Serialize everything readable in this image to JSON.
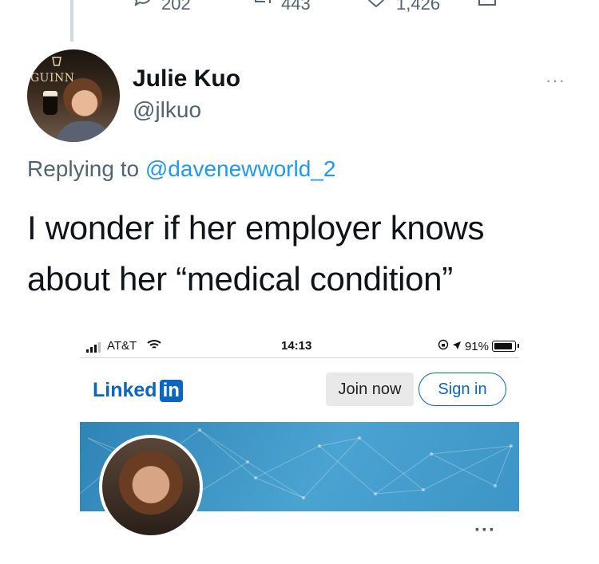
{
  "tweet_actions": {
    "replies": "202",
    "retweets": "443",
    "likes": "1,426"
  },
  "tweet": {
    "author_name": "Julie Kuo",
    "author_handle": "@jlkuo",
    "more_glyph": "···",
    "replying_prefix": "Replying to",
    "replying_to": "@davenewworld_2",
    "text": "I wonder if her employer knows about her “medical condition”",
    "avatar_sign_text": "GUINN"
  },
  "screenshot": {
    "status_bar": {
      "carrier": "AT&T",
      "time": "14:13",
      "battery": "91%",
      "battery_level": 0.91
    },
    "linkedin": {
      "logo_word": "Linked",
      "logo_box": "in",
      "join_label": "Join now",
      "signin_label": "Sign in",
      "more_glyph": "···",
      "brand_color": "#0a66c2"
    }
  },
  "colors": {
    "link_blue": "#1d9bf0",
    "secondary_text": "#536471",
    "banner_blue": "#3d95c7"
  }
}
